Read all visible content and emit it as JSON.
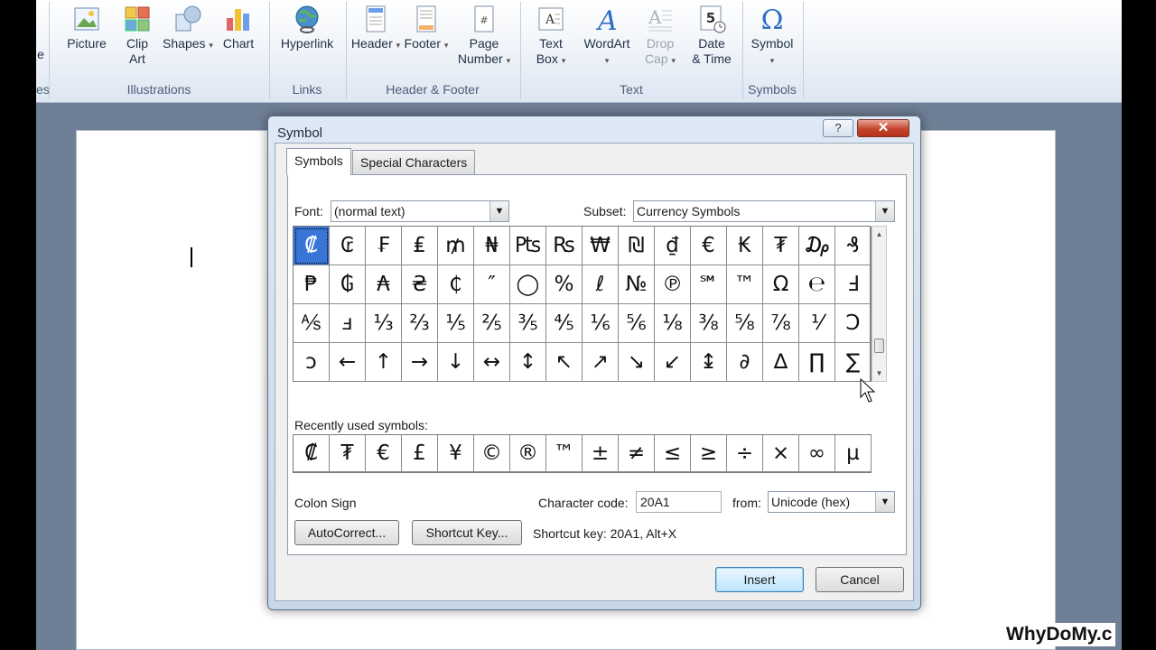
{
  "ribbon": {
    "cut_left_label": "e",
    "cut_left_group": "es",
    "groups": {
      "illustrations": "Illustrations",
      "links": "Links",
      "header_footer": "Header & Footer",
      "text": "Text",
      "symbols": "Symbols"
    },
    "buttons": {
      "picture": "Picture",
      "clip_art_1": "Clip",
      "clip_art_2": "Art",
      "shapes": "Shapes",
      "chart": "Chart",
      "hyperlink": "Hyperlink",
      "header": "Header",
      "footer": "Footer",
      "page_number_1": "Page",
      "page_number_2": "Number",
      "text_box_1": "Text",
      "text_box_2": "Box",
      "wordart": "WordArt",
      "drop_cap_1": "Drop",
      "drop_cap_2": "Cap",
      "date_time_1": "Date",
      "date_time_2": "& Time",
      "symbol": "Symbol"
    }
  },
  "dialog": {
    "title": "Symbol",
    "help": "?",
    "close": "✕",
    "tabs": [
      "Symbols",
      "Special Characters"
    ],
    "font_label": "Font:",
    "font_value": "(normal text)",
    "subset_label": "Subset:",
    "subset_value": "Currency Symbols",
    "symbols": [
      [
        "₡",
        "₢",
        "₣",
        "₤",
        "₥",
        "₦",
        "₧",
        "₨",
        "₩",
        "₪",
        "₫",
        "€",
        "₭",
        "₮",
        "₯",
        "₰"
      ],
      [
        "₱",
        "₲",
        "₳",
        "₴",
        "₵",
        "″",
        "◯",
        "%",
        "ℓ",
        "№",
        "℗",
        "℠",
        "™",
        "Ω",
        "℮",
        "Ⅎ"
      ],
      [
        "⅍",
        "ⅎ",
        "⅓",
        "⅔",
        "⅕",
        "⅖",
        "⅗",
        "⅘",
        "⅙",
        "⅚",
        "⅛",
        "⅜",
        "⅝",
        "⅞",
        "⅟",
        "Ↄ"
      ],
      [
        "ↄ",
        "←",
        "↑",
        "→",
        "↓",
        "↔",
        "↕",
        "↖",
        "↗",
        "↘",
        "↙",
        "↨",
        "∂",
        "∆",
        "∏",
        "∑"
      ]
    ],
    "recent_label": "Recently used symbols:",
    "recent": [
      "₡",
      "₮",
      "€",
      "£",
      "¥",
      "©",
      "®",
      "™",
      "±",
      "≠",
      "≤",
      "≥",
      "÷",
      "×",
      "∞",
      "µ"
    ],
    "char_name": "Colon Sign",
    "char_code_label": "Character code:",
    "char_code_value": "20A1",
    "from_label": "from:",
    "from_value": "Unicode (hex)",
    "autocorrect": "AutoCorrect...",
    "shortcut_key_btn": "Shortcut Key...",
    "shortcut_key_text": "Shortcut key: 20A1, Alt+X",
    "insert": "Insert",
    "cancel": "Cancel"
  },
  "watermark": "WhyDoMy.c"
}
